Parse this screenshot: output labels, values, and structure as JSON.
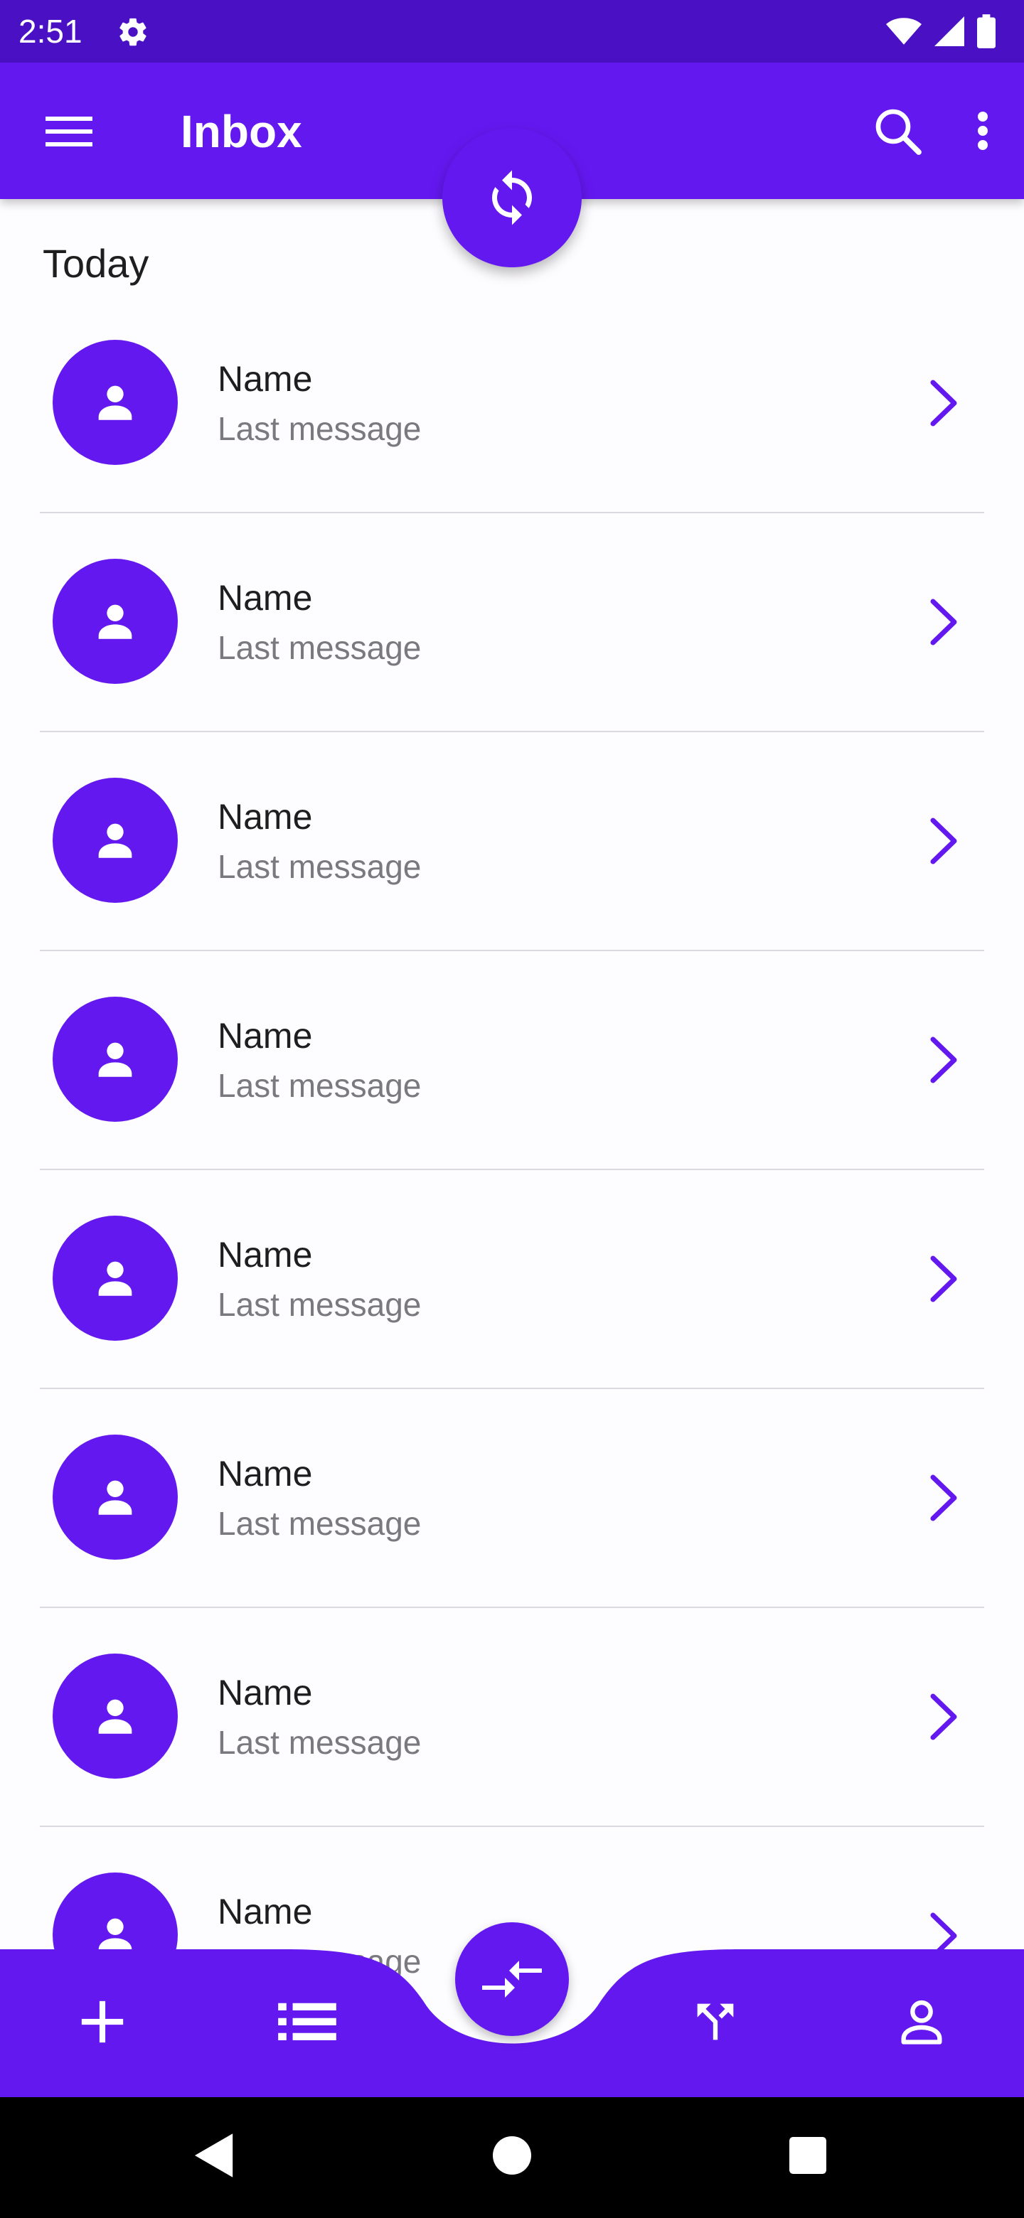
{
  "status_bar": {
    "time": "2:51",
    "icons": [
      "settings-icon",
      "wifi-icon",
      "signal-icon",
      "battery-icon"
    ]
  },
  "app_bar": {
    "title": "Inbox",
    "icons": [
      "menu-icon",
      "search-icon",
      "more-vert-icon"
    ]
  },
  "refresh_fab": {
    "icon": "refresh-icon"
  },
  "inbox": {
    "section_title": "Today",
    "items": [
      {
        "name": "Name",
        "message": "Last message"
      },
      {
        "name": "Name",
        "message": "Last message"
      },
      {
        "name": "Name",
        "message": "Last message"
      },
      {
        "name": "Name",
        "message": "Last message"
      },
      {
        "name": "Name",
        "message": "Last message"
      },
      {
        "name": "Name",
        "message": "Last message"
      },
      {
        "name": "Name",
        "message": "Last message"
      },
      {
        "name": "Name",
        "message": "Last message"
      }
    ]
  },
  "bottom_bar": {
    "icons": [
      "add-icon",
      "list-icon",
      "swap-icon",
      "fork-icon",
      "person-icon"
    ]
  },
  "system_nav": {
    "icons": [
      "back-icon",
      "home-icon",
      "recents-icon"
    ]
  },
  "colors": {
    "primary": "#6418f0",
    "status_bar": "#4a10c4",
    "surface": "#fdfcfe",
    "text_primary": "#1e1e1e",
    "text_secondary": "#7a7a7e",
    "divider": "#dcdae0"
  }
}
